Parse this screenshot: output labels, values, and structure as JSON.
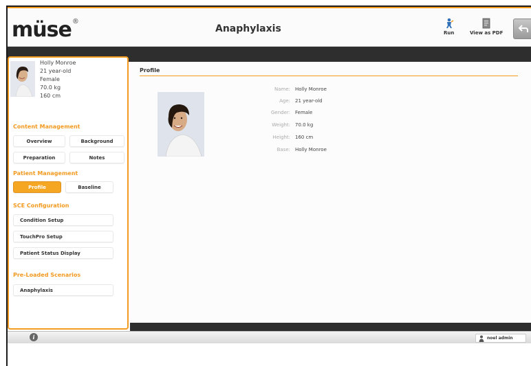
{
  "header": {
    "logo": "müse",
    "logo_mark": "®",
    "title": "Anaphylaxis",
    "run_label": "Run",
    "pdf_label": "View as PDF"
  },
  "patient": {
    "name": "Holly Monroe",
    "age": "21 year-old",
    "gender": "Female",
    "weight": "70.0 kg",
    "height": "160 cm"
  },
  "sidebar": {
    "content_management": {
      "title": "Content Management",
      "overview": "Overview",
      "background": "Background",
      "preparation": "Preparation",
      "notes": "Notes"
    },
    "patient_management": {
      "title": "Patient Management",
      "profile": "Profile",
      "baseline": "Baseline"
    },
    "sce_configuration": {
      "title": "SCE Configuration",
      "condition_setup": "Condition Setup",
      "touchpro_setup": "TouchPro Setup",
      "patient_status_display": "Patient Status Display"
    },
    "preloaded": {
      "title": "Pre-Loaded Scenarios",
      "anaphylaxis": "Anaphylaxis"
    }
  },
  "profile": {
    "tab_label": "Profile",
    "rows": [
      {
        "key": "Name:",
        "value": "Holly Monroe"
      },
      {
        "key": "Age:",
        "value": "21 year-old"
      },
      {
        "key": "Gender:",
        "value": "Female"
      },
      {
        "key": "Weight:",
        "value": "70.0 kg"
      },
      {
        "key": "Height:",
        "value": "160 cm"
      },
      {
        "key": "Base:",
        "value": "Holly Monroe"
      }
    ]
  },
  "footer": {
    "user": "noel admin"
  },
  "colors": {
    "accent": "#f39a20",
    "dark_band": "#2e2e2e"
  }
}
